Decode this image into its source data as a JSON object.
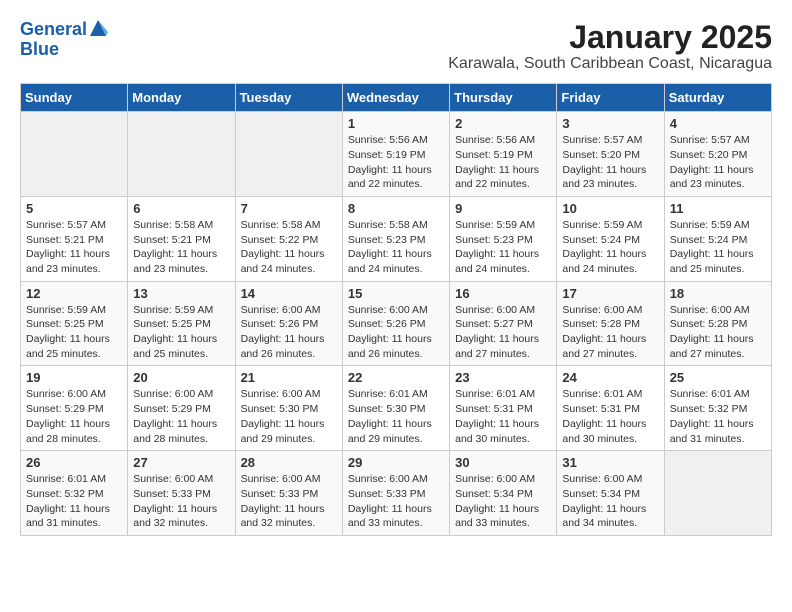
{
  "header": {
    "logo_line1": "General",
    "logo_line2": "Blue",
    "title": "January 2025",
    "subtitle": "Karawala, South Caribbean Coast, Nicaragua"
  },
  "weekdays": [
    "Sunday",
    "Monday",
    "Tuesday",
    "Wednesday",
    "Thursday",
    "Friday",
    "Saturday"
  ],
  "weeks": [
    [
      {
        "day": "",
        "info": ""
      },
      {
        "day": "",
        "info": ""
      },
      {
        "day": "",
        "info": ""
      },
      {
        "day": "1",
        "info": "Sunrise: 5:56 AM\nSunset: 5:19 PM\nDaylight: 11 hours\nand 22 minutes."
      },
      {
        "day": "2",
        "info": "Sunrise: 5:56 AM\nSunset: 5:19 PM\nDaylight: 11 hours\nand 22 minutes."
      },
      {
        "day": "3",
        "info": "Sunrise: 5:57 AM\nSunset: 5:20 PM\nDaylight: 11 hours\nand 23 minutes."
      },
      {
        "day": "4",
        "info": "Sunrise: 5:57 AM\nSunset: 5:20 PM\nDaylight: 11 hours\nand 23 minutes."
      }
    ],
    [
      {
        "day": "5",
        "info": "Sunrise: 5:57 AM\nSunset: 5:21 PM\nDaylight: 11 hours\nand 23 minutes."
      },
      {
        "day": "6",
        "info": "Sunrise: 5:58 AM\nSunset: 5:21 PM\nDaylight: 11 hours\nand 23 minutes."
      },
      {
        "day": "7",
        "info": "Sunrise: 5:58 AM\nSunset: 5:22 PM\nDaylight: 11 hours\nand 24 minutes."
      },
      {
        "day": "8",
        "info": "Sunrise: 5:58 AM\nSunset: 5:23 PM\nDaylight: 11 hours\nand 24 minutes."
      },
      {
        "day": "9",
        "info": "Sunrise: 5:59 AM\nSunset: 5:23 PM\nDaylight: 11 hours\nand 24 minutes."
      },
      {
        "day": "10",
        "info": "Sunrise: 5:59 AM\nSunset: 5:24 PM\nDaylight: 11 hours\nand 24 minutes."
      },
      {
        "day": "11",
        "info": "Sunrise: 5:59 AM\nSunset: 5:24 PM\nDaylight: 11 hours\nand 25 minutes."
      }
    ],
    [
      {
        "day": "12",
        "info": "Sunrise: 5:59 AM\nSunset: 5:25 PM\nDaylight: 11 hours\nand 25 minutes."
      },
      {
        "day": "13",
        "info": "Sunrise: 5:59 AM\nSunset: 5:25 PM\nDaylight: 11 hours\nand 25 minutes."
      },
      {
        "day": "14",
        "info": "Sunrise: 6:00 AM\nSunset: 5:26 PM\nDaylight: 11 hours\nand 26 minutes."
      },
      {
        "day": "15",
        "info": "Sunrise: 6:00 AM\nSunset: 5:26 PM\nDaylight: 11 hours\nand 26 minutes."
      },
      {
        "day": "16",
        "info": "Sunrise: 6:00 AM\nSunset: 5:27 PM\nDaylight: 11 hours\nand 27 minutes."
      },
      {
        "day": "17",
        "info": "Sunrise: 6:00 AM\nSunset: 5:28 PM\nDaylight: 11 hours\nand 27 minutes."
      },
      {
        "day": "18",
        "info": "Sunrise: 6:00 AM\nSunset: 5:28 PM\nDaylight: 11 hours\nand 27 minutes."
      }
    ],
    [
      {
        "day": "19",
        "info": "Sunrise: 6:00 AM\nSunset: 5:29 PM\nDaylight: 11 hours\nand 28 minutes."
      },
      {
        "day": "20",
        "info": "Sunrise: 6:00 AM\nSunset: 5:29 PM\nDaylight: 11 hours\nand 28 minutes."
      },
      {
        "day": "21",
        "info": "Sunrise: 6:00 AM\nSunset: 5:30 PM\nDaylight: 11 hours\nand 29 minutes."
      },
      {
        "day": "22",
        "info": "Sunrise: 6:01 AM\nSunset: 5:30 PM\nDaylight: 11 hours\nand 29 minutes."
      },
      {
        "day": "23",
        "info": "Sunrise: 6:01 AM\nSunset: 5:31 PM\nDaylight: 11 hours\nand 30 minutes."
      },
      {
        "day": "24",
        "info": "Sunrise: 6:01 AM\nSunset: 5:31 PM\nDaylight: 11 hours\nand 30 minutes."
      },
      {
        "day": "25",
        "info": "Sunrise: 6:01 AM\nSunset: 5:32 PM\nDaylight: 11 hours\nand 31 minutes."
      }
    ],
    [
      {
        "day": "26",
        "info": "Sunrise: 6:01 AM\nSunset: 5:32 PM\nDaylight: 11 hours\nand 31 minutes."
      },
      {
        "day": "27",
        "info": "Sunrise: 6:00 AM\nSunset: 5:33 PM\nDaylight: 11 hours\nand 32 minutes."
      },
      {
        "day": "28",
        "info": "Sunrise: 6:00 AM\nSunset: 5:33 PM\nDaylight: 11 hours\nand 32 minutes."
      },
      {
        "day": "29",
        "info": "Sunrise: 6:00 AM\nSunset: 5:33 PM\nDaylight: 11 hours\nand 33 minutes."
      },
      {
        "day": "30",
        "info": "Sunrise: 6:00 AM\nSunset: 5:34 PM\nDaylight: 11 hours\nand 33 minutes."
      },
      {
        "day": "31",
        "info": "Sunrise: 6:00 AM\nSunset: 5:34 PM\nDaylight: 11 hours\nand 34 minutes."
      },
      {
        "day": "",
        "info": ""
      }
    ]
  ]
}
